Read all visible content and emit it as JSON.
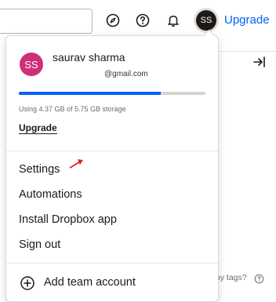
{
  "topbar": {
    "icons": [
      "compass-icon",
      "help-icon",
      "bell-icon"
    ],
    "avatar_initials": "SS",
    "upgrade_label": "Upgrade"
  },
  "account_menu": {
    "avatar_initials": "SS",
    "user_name": "saurav sharma",
    "user_email": "@gmail.com",
    "storage_used_fraction": 0.76,
    "storage_text": "Using 4.37 GB of 5.75 GB storage",
    "upgrade_label": "Upgrade",
    "items": [
      {
        "label": "Settings"
      },
      {
        "label": "Automations"
      },
      {
        "label": "Install Dropbox app"
      },
      {
        "label": "Sign out"
      }
    ],
    "add_team_label": "Add team account"
  },
  "background": {
    "hint_text": "my tags?"
  },
  "colors": {
    "accent": "#0061fe",
    "avatar_menu": "#cd2f7b",
    "avatar_top": "#1e1919",
    "annotation_arrow": "#e0241b"
  }
}
